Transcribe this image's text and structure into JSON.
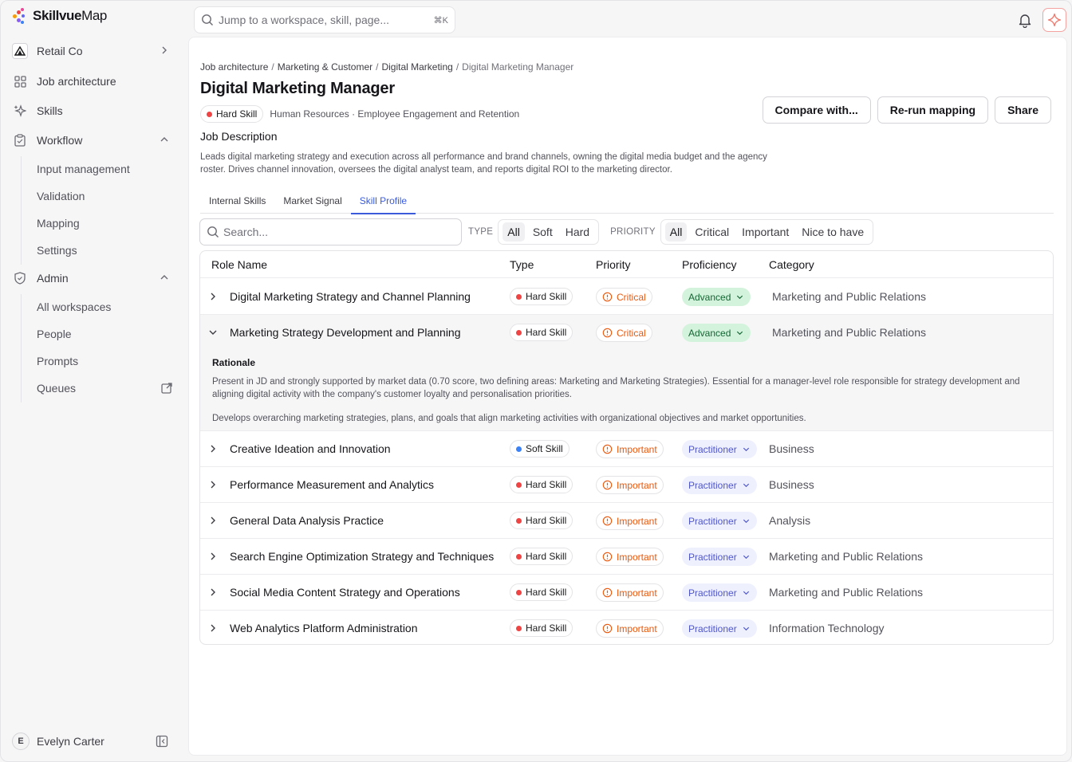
{
  "brand": {
    "name_bold": "Skillvue",
    "name_light": "Map"
  },
  "sidebar": {
    "workspace": "Retail Co",
    "items": [
      {
        "label": "Job architecture"
      },
      {
        "label": "Skills"
      },
      {
        "label": "Workflow"
      },
      {
        "label": "Admin"
      }
    ],
    "workflow_sub": [
      "Input management",
      "Validation",
      "Mapping",
      "Settings"
    ],
    "admin_sub": [
      "All workspaces",
      "People",
      "Prompts",
      "Queues"
    ],
    "user": {
      "initial": "E",
      "name": "Evelyn Carter"
    }
  },
  "topbar": {
    "search_placeholder": "Jump to a workspace, skill, page...",
    "shortcut": "⌘K"
  },
  "breadcrumb": [
    "Job architecture",
    "Marketing & Customer",
    "Digital Marketing",
    "Digital Marketing Manager"
  ],
  "page": {
    "title": "Digital Marketing Manager",
    "skill_type": "Hard Skill",
    "meta": "Human Resources · Employee Engagement and Retention",
    "actions": {
      "compare": "Compare with...",
      "rerun": "Re-run mapping",
      "share": "Share"
    },
    "jd_title": "Job Description",
    "jd_text": "Leads digital marketing strategy and execution across all performance and brand channels, owning the digital media budget and the agency roster. Drives channel innovation, oversees the digital analyst team, and reports digital ROI to the marketing director."
  },
  "tabs": [
    "Internal Skills",
    "Market Signal",
    "Skill Profile"
  ],
  "filters": {
    "search_placeholder": "Search...",
    "type_label": "TYPE",
    "type_options": [
      "All",
      "Soft",
      "Hard"
    ],
    "priority_label": "PRIORITY",
    "priority_options": [
      "All",
      "Critical",
      "Important",
      "Nice to have"
    ]
  },
  "table": {
    "headers": [
      "Role Name",
      "Type",
      "Priority",
      "Proficiency",
      "Category"
    ],
    "rows": [
      {
        "name": "Digital Marketing Strategy and Channel Planning",
        "type": "Hard Skill",
        "priority": "Critical",
        "proficiency": "Advanced",
        "category": "Marketing and Public Relations"
      },
      {
        "name": "Marketing Strategy Development and Planning",
        "type": "Hard Skill",
        "priority": "Critical",
        "proficiency": "Advanced",
        "category": "Marketing and Public Relations"
      },
      {
        "name": "Creative Ideation and Innovation",
        "type": "Soft Skill",
        "priority": "Important",
        "proficiency": "Practitioner",
        "category": "Business"
      },
      {
        "name": "Performance Measurement and Analytics",
        "type": "Hard Skill",
        "priority": "Important",
        "proficiency": "Practitioner",
        "category": "Business"
      },
      {
        "name": "General Data Analysis Practice",
        "type": "Hard Skill",
        "priority": "Important",
        "proficiency": "Practitioner",
        "category": "Analysis"
      },
      {
        "name": "Search Engine Optimization Strategy and Techniques",
        "type": "Hard Skill",
        "priority": "Important",
        "proficiency": "Practitioner",
        "category": "Marketing and Public Relations"
      },
      {
        "name": "Social Media Content Strategy and Operations",
        "type": "Hard Skill",
        "priority": "Important",
        "proficiency": "Practitioner",
        "category": "Marketing and Public Relations"
      },
      {
        "name": "Web Analytics Platform Administration",
        "type": "Hard Skill",
        "priority": "Important",
        "proficiency": "Practitioner",
        "category": "Information Technology"
      }
    ],
    "rationale": {
      "title": "Rationale",
      "text1": "Present in JD and strongly supported by market data (0.70 score, two defining areas: Marketing and Marketing Strategies). Essential for a manager-level role responsible for strategy development and aligning digital activity with the company's customer loyalty and personalisation priorities.",
      "text2": "Develops overarching marketing strategies, plans, and goals that align marketing activities with organizational objectives and market opportunities."
    }
  },
  "colors": {
    "accent": "#3b5bdb",
    "hard_dot": "#ef4444",
    "soft_dot": "#3b82f6",
    "priority": "#ea580c",
    "advanced_bg": "#d3f3dc",
    "practitioner_bg": "#eef0fe"
  }
}
